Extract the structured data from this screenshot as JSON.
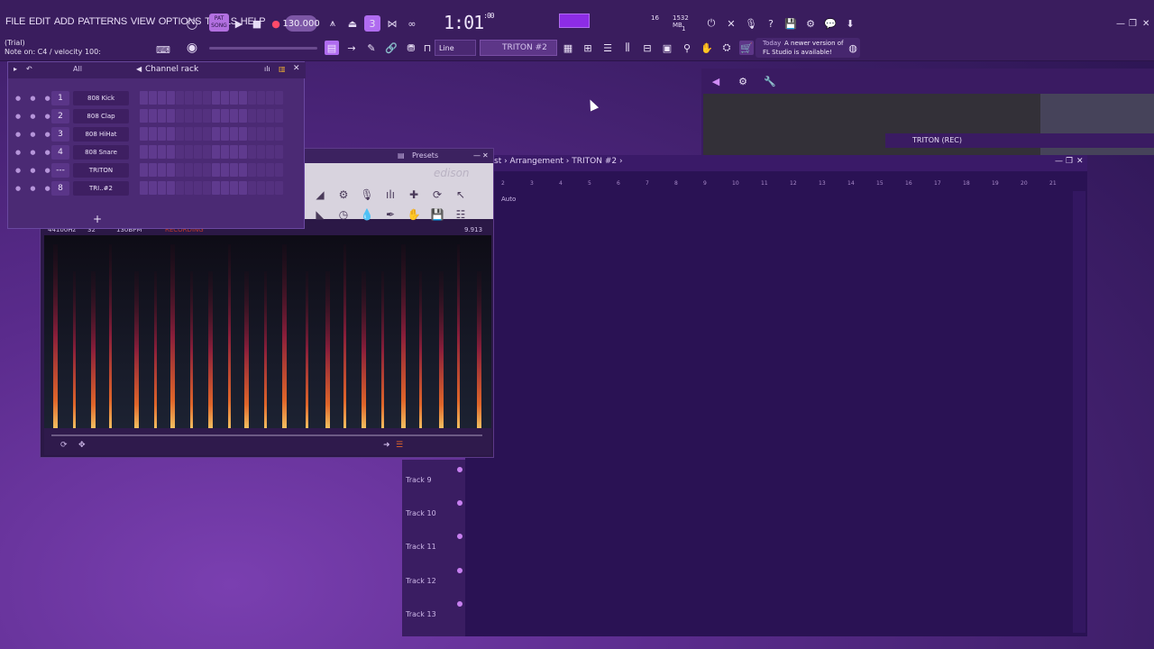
{
  "menu": [
    "FILE",
    "EDIT",
    "ADD",
    "PATTERNS",
    "VIEW",
    "OPTIONS",
    "TOOLS",
    "HELP"
  ],
  "hint": {
    "line1": "(Trial)",
    "line2": "Note on: C4 / velocity 100:"
  },
  "transport": {
    "pat_label": "PAT SONG",
    "tempo": "130.000",
    "time": "1:01",
    "time_small": ":00",
    "time_unit": "B:S:T"
  },
  "stats": {
    "cpu": "16",
    "mem": "1532 MB",
    "poly": "1",
    "sub": "0"
  },
  "snap": {
    "label": "Line"
  },
  "pattern": {
    "label": "TRITON #2"
  },
  "news": {
    "date": "Today",
    "line1": "A newer version of",
    "line2": "FL Studio is available!"
  },
  "channel_rack": {
    "title": "Channel rack",
    "filter": "All",
    "channels": [
      {
        "num": "1",
        "name": "808 Kick"
      },
      {
        "num": "2",
        "name": "808 Clap"
      },
      {
        "num": "3",
        "name": "808 HiHat"
      },
      {
        "num": "4",
        "name": "808 Snare"
      },
      {
        "num": "---",
        "name": "TRITON"
      },
      {
        "num": "8",
        "name": "TRI..#2"
      }
    ]
  },
  "edison": {
    "presets_label": "Presets",
    "logo": "edison",
    "info": {
      "rate": "44100Hz",
      "bits": "32",
      "bpm": "130BPM",
      "status": "RECORDING",
      "length": "9.913"
    }
  },
  "playlist": {
    "crumb": "st › Arrangement › TRITON #2 ›",
    "auto_label": "Auto",
    "ruler": [
      "2",
      "3",
      "4",
      "5",
      "6",
      "7",
      "8",
      "9",
      "10",
      "11",
      "12",
      "13",
      "14",
      "15",
      "16",
      "17",
      "18",
      "19",
      "20",
      "21"
    ],
    "tracks": [
      "Track 9",
      "Track 10",
      "Track 11",
      "Track 12",
      "Track 13"
    ]
  },
  "mixer": {
    "triton_label": "TRITON (REC)"
  },
  "colors": {
    "accent": "#8d2ce6",
    "bg": "#3a1d5e",
    "spectrum_hot": "#e8a040"
  }
}
